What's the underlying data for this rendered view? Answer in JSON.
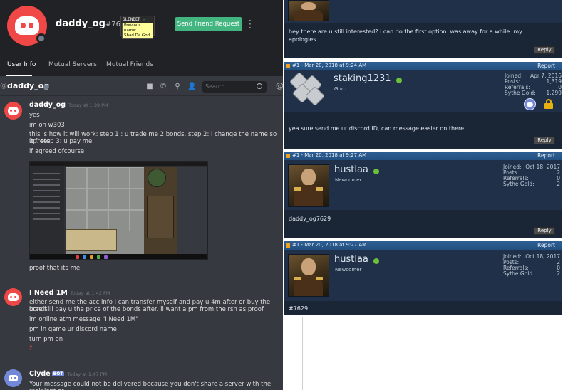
{
  "discord": {
    "profile": {
      "username": "daddy_og",
      "discriminator": "#7629",
      "badge_title": "SLENDER",
      "badge_tooltip_line1": "Previous name:",
      "badge_tooltip_line2": "Shad Da God",
      "send_friend_request": "Send Friend Request",
      "tabs": [
        "User Info",
        "Mutual Servers",
        "Mutual Friends"
      ],
      "status_color": "#747f8d"
    },
    "channel": {
      "at_symbol": "@",
      "name": "daddy_og",
      "search_placeholder": "Search",
      "icons": [
        "video-call-icon",
        "phone-icon",
        "pin-icon",
        "add-friend-icon",
        "search-icon",
        "mention-icon"
      ]
    },
    "messages": [
      {
        "author": "daddy_og",
        "timestamp": "Today at 1:39 PM",
        "lines": [
          "yes",
          "im on w303",
          "this is how it will work: step 1 : u trade me 2 bonds. step 2: i change the name so it frees",
          "up. step 3: u pay me",
          "if agreed ofcourse"
        ],
        "after_image": "proof that its me"
      },
      {
        "author": "I Need 1M",
        "timestamp": "Today at 1:42 PM",
        "lines": [
          "either send me the acc info i can transfer myself and pay u 4m after or buy the bonds",
          "urself ill pay u the price of the bonds after. il want a pm from the rsn as proof",
          "im online atm message \"I Need 1M\"",
          "pm in game ur discord name",
          "turn pm on",
          "?"
        ]
      },
      {
        "author": "Clyde",
        "bot_tag": "BOT",
        "timestamp": "Today at 1:47 PM",
        "lines": [
          "Your message could not be delivered because you don't share a server with the recipient or"
        ]
      }
    ],
    "colors": {
      "brand": "#f04747",
      "accent_green": "#43b581",
      "bg": "#36393f",
      "header_bg": "#202225"
    }
  },
  "forum": {
    "posts": [
      {
        "text_lines": [
          "hey there are u still interested? i can do the first option. was away for a while. my",
          "apologies"
        ],
        "reply": "Reply"
      },
      {
        "post_id": "#1 - Mar 20, 2018 at 9:24 AM",
        "report": "Report",
        "username": "staking1231",
        "rank": "Guru",
        "stats": [
          {
            "label": "Joined:",
            "value": "Apr 7, 2016"
          },
          {
            "label": "Posts:",
            "value": "1,319"
          },
          {
            "label": "Referrals:",
            "value": "0"
          },
          {
            "label": "Sythe Gold:",
            "value": "1,299"
          }
        ],
        "text_lines": [
          "yea sure send me ur discord ID, can message easier on there"
        ],
        "reply": "Reply"
      },
      {
        "post_id": "#1 - Mar 20, 2018 at 9:27 AM",
        "report": "Report",
        "username": "hustlaa",
        "rank": "Newcomer",
        "stats": [
          {
            "label": "Joined:",
            "value": "Oct 18, 2017"
          },
          {
            "label": "Posts:",
            "value": "2"
          },
          {
            "label": "Referrals:",
            "value": "0"
          },
          {
            "label": "Sythe Gold:",
            "value": "2"
          }
        ],
        "text_lines": [
          "daddy_og7629"
        ],
        "reply": "Reply"
      },
      {
        "post_id": "#1 - Mar 20, 2018 at 9:27 AM",
        "report": "Report",
        "username": "hustlaa",
        "rank": "Newcomer",
        "stats": [
          {
            "label": "Joined:",
            "value": "Oct 18, 2017"
          },
          {
            "label": "Posts:",
            "value": "2"
          },
          {
            "label": "Referrals:",
            "value": "0"
          },
          {
            "label": "Sythe Gold:",
            "value": "2"
          }
        ],
        "text_lines": [
          "#7629"
        ]
      }
    ],
    "colors": {
      "post_bg": "#1f2c3d",
      "bar": "#2e5f95",
      "online": "#6bbf3a"
    }
  }
}
